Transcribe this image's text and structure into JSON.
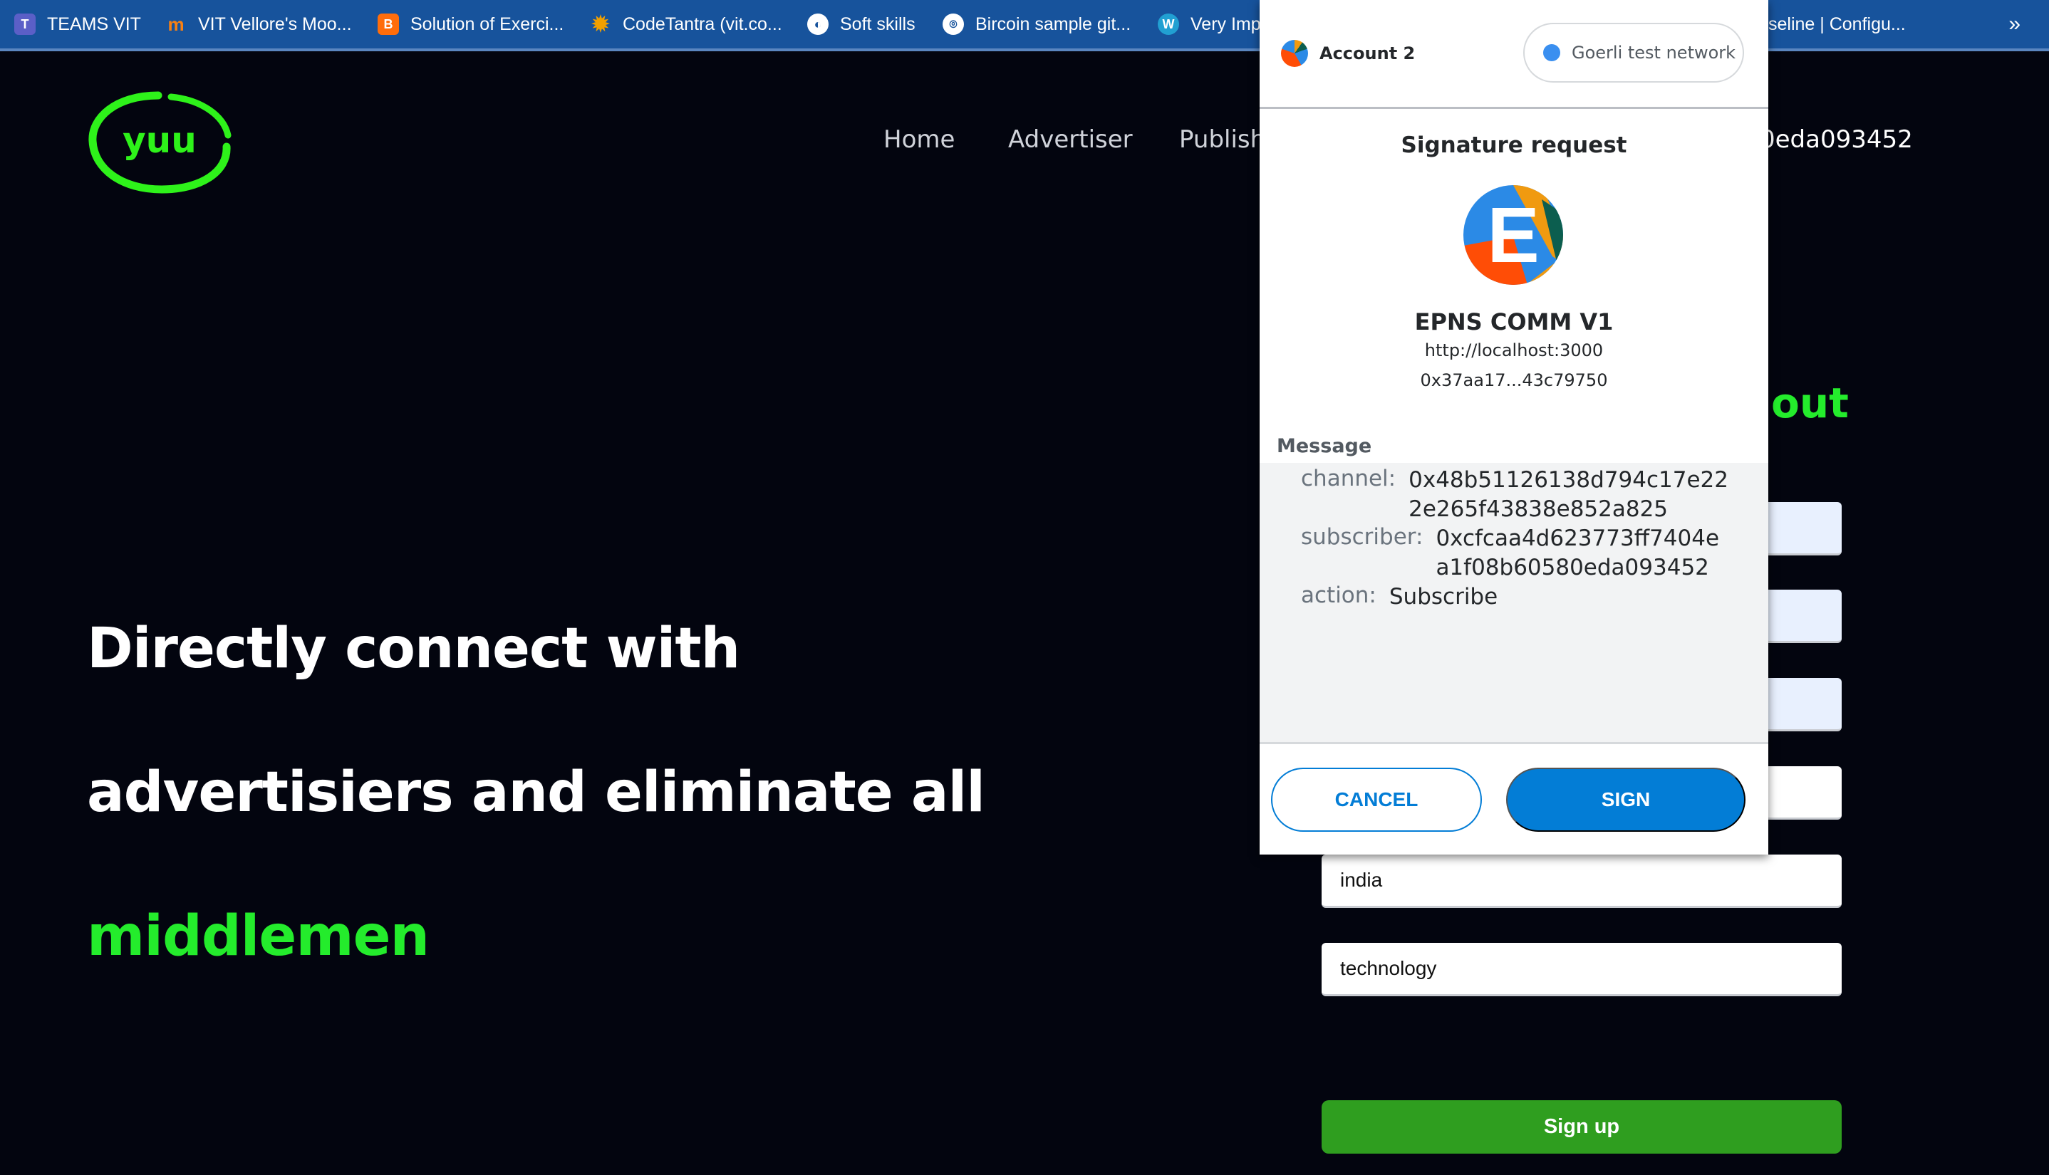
{
  "bookmarks": {
    "items": [
      {
        "label": "TEAMS VIT",
        "icon": "teams-icon"
      },
      {
        "label": "VIT Vellore's Moo...",
        "icon": "moodle-icon"
      },
      {
        "label": "Solution of Exerci...",
        "icon": "blogger-icon"
      },
      {
        "label": "CodeTantra (vit.co...",
        "icon": "codetantra-icon"
      },
      {
        "label": "Soft skills",
        "icon": "globe-icon"
      },
      {
        "label": "Bircoin sample git...",
        "icon": "github-icon"
      },
      {
        "label": "Very Imp",
        "icon": "wordpress-icon"
      },
      {
        "label": "seline | Configu...",
        "icon": ""
      }
    ],
    "more": "»"
  },
  "site": {
    "logo_text": "yuu",
    "nav": [
      "Home",
      "Advertiser",
      "Publish"
    ],
    "account_addr_visible": "0eda093452",
    "hero": {
      "line1": "Directly connect with",
      "line2": "advertisiers and eliminate all",
      "line3": "middlemen"
    },
    "form_title_visible": "out",
    "fields": [
      {
        "value": "",
        "autofill": true
      },
      {
        "value": "",
        "autofill": true
      },
      {
        "value": "",
        "autofill": true
      },
      {
        "value": "",
        "autofill": false
      },
      {
        "value": "india",
        "autofill": false
      },
      {
        "value": "technology",
        "autofill": false
      }
    ],
    "signup_label": "Sign up",
    "colors": {
      "accent_green": "#24ec2c",
      "signup_green": "#2f9e1f",
      "background": "#03050f"
    }
  },
  "metamask": {
    "account_name": "Account 2",
    "network": "Goerli test network",
    "title": "Signature request",
    "origin_logo_letter": "E",
    "origin_name": "EPNS COMM V1",
    "origin_url": "http://localhost:3000",
    "contract_address": "0x37aa17...43c79750",
    "message_label": "Message",
    "message": [
      {
        "key": "channel:",
        "value": "0x48b51126138d794c17e222e265f43838e852a825"
      },
      {
        "key": "subscriber:",
        "value": "0xcfcaa4d623773ff7404ea1f08b60580eda093452"
      },
      {
        "key": "action:",
        "value": "Subscribe"
      }
    ],
    "cancel_label": "CANCEL",
    "sign_label": "SIGN",
    "colors": {
      "primary": "#037dd6"
    }
  }
}
